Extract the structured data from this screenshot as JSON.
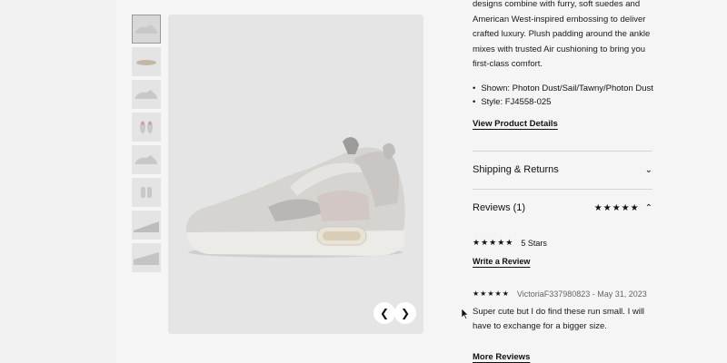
{
  "product": {
    "description": "designs combine with furry, soft suedes and American West-inspired embossing to deliver crafted luxury. Plush padding around the ankle mixes with trusted Air cushioning to bring you first-class comfort.",
    "details": [
      "Shown: Photon Dust/Sail/Tawny/Photon Dust",
      "Style: FJ4558-025"
    ],
    "view_details_label": "View Product Details"
  },
  "gallery": {
    "thumbnails": [
      "side",
      "sole",
      "side",
      "front",
      "side",
      "back",
      "detail",
      "detail"
    ],
    "prev_icon": "chevron-left-icon",
    "next_icon": "chevron-right-icon"
  },
  "shipping": {
    "title": "Shipping & Returns",
    "icon": "chevron-down-icon"
  },
  "reviews": {
    "title": "Reviews (1)",
    "header_stars": "★★★★★",
    "icon": "chevron-up-icon",
    "summary_stars": "★★★★★",
    "summary_label": "5 Stars",
    "write_label": "Write a Review",
    "items": [
      {
        "stars": "★★★★★",
        "author_date": "VictoriaF337980823 - May 31, 2023",
        "body": "Super cute but I do find these run small. I will have to exchange for a bigger size."
      }
    ],
    "more_label": "More Reviews"
  },
  "colors": {
    "background": "#f2f2f2",
    "image_bg": "#e5e5e5",
    "text": "#111111"
  }
}
